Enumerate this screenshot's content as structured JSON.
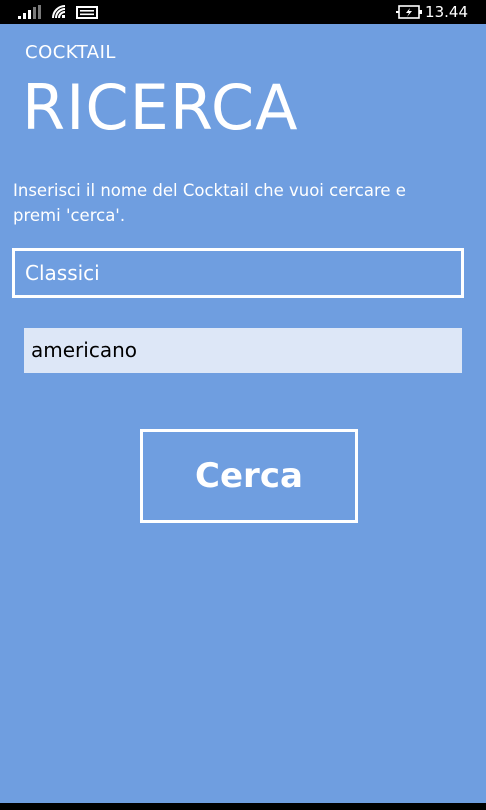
{
  "status_bar": {
    "time": "13.44",
    "icons": [
      "signal-icon",
      "wifi-icon",
      "message-icon",
      "battery-icon"
    ],
    "signal_level": 0.6
  },
  "header": {
    "app_title": "COCKTAIL",
    "page_title": "RICERCA"
  },
  "main": {
    "instructions": "Inserisci il nome del Cocktail che vuoi cercare e premi 'cerca'.",
    "category": {
      "selected": "Classici"
    },
    "search": {
      "value": "americano"
    },
    "search_button_label": "Cerca"
  },
  "colors": {
    "background": "#6f9ee0",
    "input_background": "#dde7f7",
    "text": "#ffffff",
    "status_bar": "#000000"
  }
}
